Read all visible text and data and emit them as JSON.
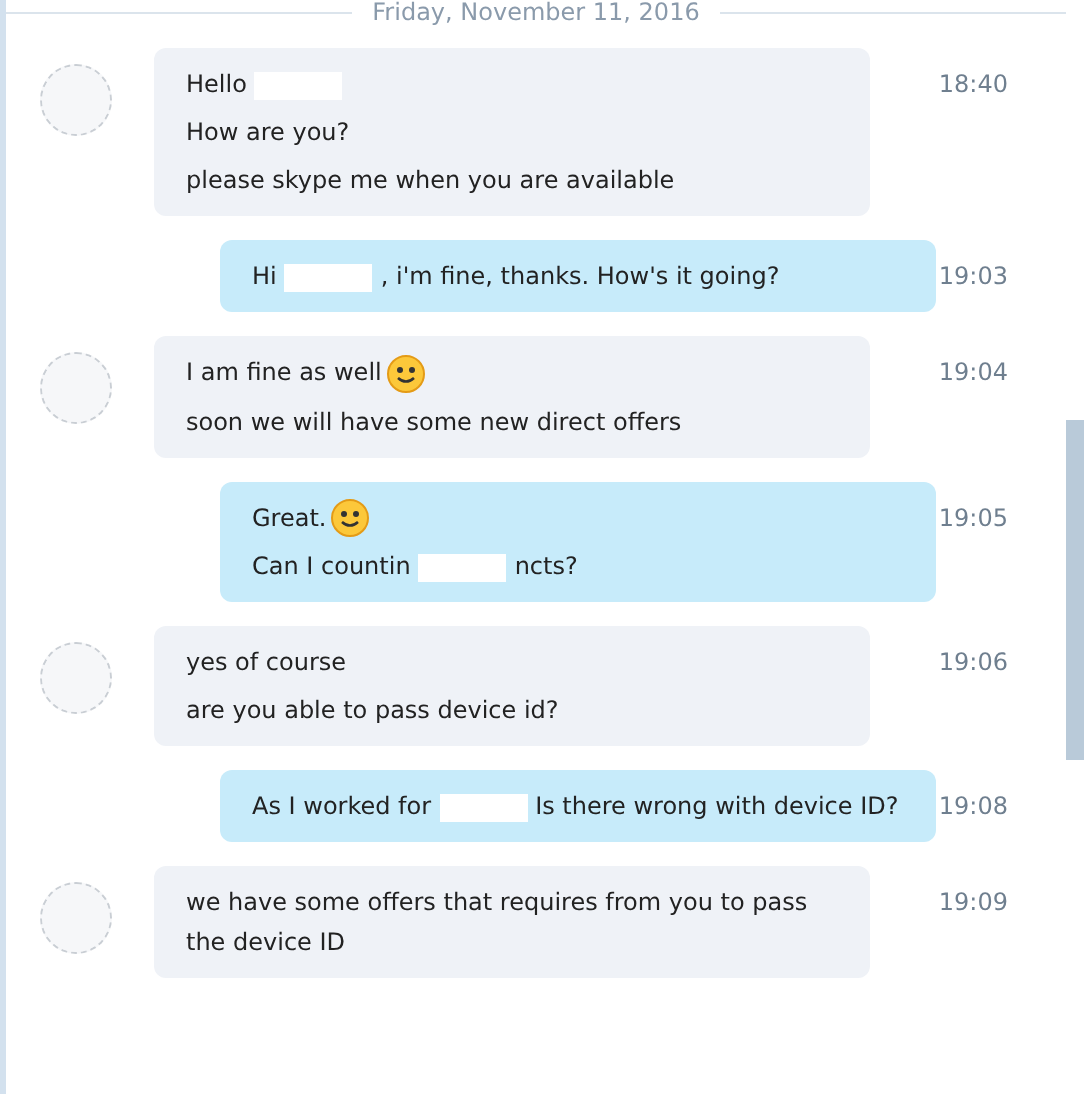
{
  "date_header": "Friday, November 11, 2016",
  "messages": [
    {
      "kind": "received",
      "time": "18:40",
      "lines": [
        [
          {
            "kind": "text",
            "text": "Hello"
          },
          {
            "kind": "redacted"
          }
        ],
        [
          {
            "kind": "text",
            "text": "How are you?"
          }
        ],
        [
          {
            "kind": "text",
            "text": "please skype me when you are available"
          }
        ]
      ]
    },
    {
      "kind": "sent",
      "time": "19:03",
      "lines": [
        [
          {
            "kind": "text",
            "text": "Hi"
          },
          {
            "kind": "redacted"
          },
          {
            "kind": "text",
            "text": ", i'm fine, thanks. How's it going?"
          }
        ]
      ]
    },
    {
      "kind": "received",
      "time": "19:04",
      "lines": [
        [
          {
            "kind": "text",
            "text": "I am fine as well"
          },
          {
            "kind": "emoji"
          }
        ],
        [
          {
            "kind": "text",
            "text": "soon we will have some new direct offers"
          }
        ]
      ]
    },
    {
      "kind": "sent",
      "time": "19:05",
      "lines": [
        [
          {
            "kind": "text",
            "text": "Great."
          },
          {
            "kind": "emoji"
          }
        ],
        [
          {
            "kind": "text",
            "text": "Can I countin"
          },
          {
            "kind": "redacted"
          },
          {
            "kind": "text",
            "text": "ncts?"
          }
        ]
      ]
    },
    {
      "kind": "received",
      "time": "19:06",
      "lines": [
        [
          {
            "kind": "text",
            "text": "yes of course"
          }
        ],
        [
          {
            "kind": "text",
            "text": "are you able to pass device id?"
          }
        ]
      ]
    },
    {
      "kind": "sent",
      "time": "19:08",
      "lines": [
        [
          {
            "kind": "text",
            "text": "As I worked for"
          },
          {
            "kind": "redacted"
          },
          {
            "kind": "text",
            "text": "Is there wrong with device ID?"
          }
        ]
      ]
    },
    {
      "kind": "received",
      "time": "19:09",
      "lines": [
        [
          {
            "kind": "text",
            "text": "we have some offers that requires from you to pass the device ID"
          }
        ]
      ]
    }
  ]
}
